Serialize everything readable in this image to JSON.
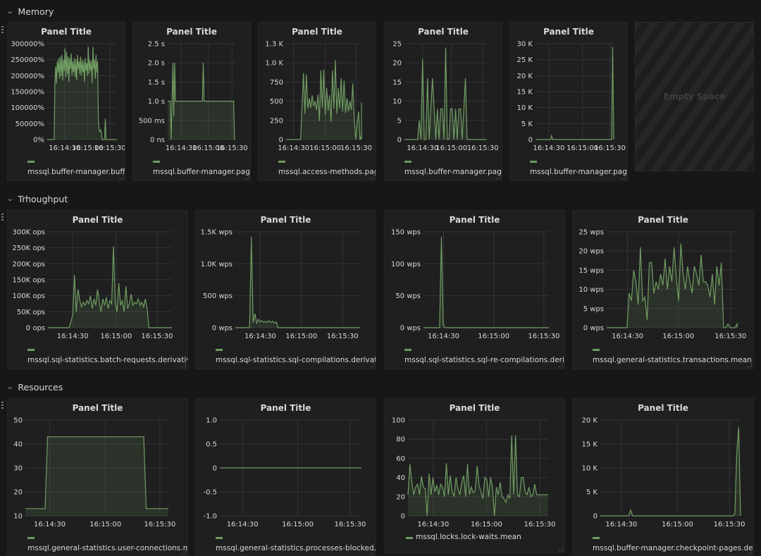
{
  "rows": [
    {
      "title": "Memory"
    },
    {
      "title": "Trhoughput"
    },
    {
      "title": "Resources"
    }
  ],
  "empty_space_label": "Empty Space",
  "series_color": "#7eb26d",
  "chart_data": [
    {
      "id": "p0",
      "type": "area",
      "title": "Panel Title",
      "row": "Memory",
      "y_ticks": [
        "300000%",
        "250000%",
        "200000%",
        "150000%",
        "100000%",
        "50000%",
        "0%"
      ],
      "ylim": [
        0,
        300000
      ],
      "x_ticks": [
        "16:14:30",
        "16:15:00",
        "16:15:30"
      ],
      "legend": "mssql.buffer-manager.buffer-ca",
      "x": [
        0,
        3,
        6,
        9,
        10,
        11,
        12,
        13,
        14,
        15,
        16,
        17,
        18,
        19,
        20,
        21,
        22,
        23,
        24,
        25,
        26,
        27,
        28,
        29,
        30,
        31,
        32,
        33,
        34,
        35,
        36,
        37,
        38,
        39,
        40,
        41,
        42,
        43,
        44,
        45,
        46,
        47,
        48,
        49,
        50,
        51,
        52,
        53,
        54,
        55,
        56,
        57,
        58,
        59,
        60,
        61,
        62,
        63,
        64,
        65,
        66,
        67,
        68,
        69,
        70,
        71,
        72,
        73,
        74,
        75,
        76,
        77,
        78,
        79,
        80,
        82,
        84,
        86,
        88,
        90
      ],
      "values": [
        0,
        0,
        0,
        0,
        180000,
        230000,
        175000,
        245000,
        210000,
        255000,
        190000,
        260000,
        200000,
        265000,
        185000,
        250000,
        215000,
        285000,
        195000,
        275000,
        205000,
        260000,
        180000,
        255000,
        220000,
        270000,
        200000,
        245000,
        210000,
        255000,
        195000,
        250000,
        185000,
        265000,
        220000,
        245000,
        205000,
        260000,
        200000,
        250000,
        210000,
        245000,
        180000,
        255000,
        215000,
        240000,
        200000,
        290000,
        205000,
        250000,
        215000,
        245000,
        175000,
        290000,
        220000,
        250000,
        190000,
        265000,
        210000,
        245000,
        60000,
        30000,
        25000,
        30000,
        20000,
        0,
        0,
        0,
        0,
        65000,
        0,
        0,
        0,
        0,
        0,
        0,
        0,
        0,
        0,
        0
      ],
      "x_range": [
        0,
        90
      ]
    },
    {
      "id": "p1",
      "type": "area",
      "title": "Panel Title",
      "row": "Memory",
      "y_ticks": [
        "2.5 s",
        "2.0 s",
        "1.5 s",
        "1.0 s",
        "500 ms",
        "0 ns"
      ],
      "ylim": [
        0,
        2.5
      ],
      "x_ticks": [
        "16:14:30",
        "16:15:00",
        "16:15:30"
      ],
      "legend": "mssql.buffer-manager.page-life",
      "x": [
        0,
        3,
        4,
        5,
        6,
        7,
        8,
        9,
        10,
        11,
        40,
        41,
        42,
        76,
        77,
        78
      ],
      "values": [
        1,
        1,
        0,
        1,
        2,
        0.6,
        2,
        1,
        1,
        1,
        1,
        2,
        1,
        1,
        0,
        0
      ],
      "x_range": [
        0,
        78
      ]
    },
    {
      "id": "p2",
      "type": "area",
      "title": "Panel Title",
      "row": "Memory",
      "y_ticks": [
        "1.3 K",
        "1.0 K",
        "750",
        "500",
        "250",
        "0"
      ],
      "ylim": [
        0,
        1300
      ],
      "x_ticks": [
        "16:14:30",
        "16:15:00",
        "16:15:30"
      ],
      "legend": "mssql.access-methods.page-spl",
      "x": [
        0,
        10,
        12,
        13,
        14,
        15,
        16,
        17,
        18,
        19,
        20,
        21,
        22,
        23,
        24,
        25,
        26,
        27,
        28,
        29,
        30,
        31,
        32,
        33,
        34,
        35,
        36,
        37,
        38,
        39,
        40,
        41,
        42,
        43,
        44,
        45,
        46,
        47,
        48,
        49,
        50,
        51,
        52,
        53,
        54,
        55,
        56,
        57,
        58,
        59,
        60,
        61,
        62,
        63,
        64,
        65,
        66,
        67,
        68,
        69,
        70,
        71,
        72
      ],
      "values": [
        0,
        0,
        900,
        350,
        880,
        420,
        560,
        430,
        600,
        450,
        520,
        400,
        610,
        250,
        940,
        430,
        950,
        330,
        700,
        390,
        600,
        240,
        940,
        420,
        1080,
        350,
        700,
        420,
        830,
        380,
        800,
        360,
        560,
        380,
        520,
        400,
        760,
        300,
        0,
        200,
        380,
        0,
        50,
        500,
        0,
        0,
        0,
        0,
        0,
        0,
        0,
        0,
        0,
        0,
        0,
        0,
        0,
        0,
        0,
        0,
        0,
        0,
        0
      ],
      "x_range": [
        0,
        52
      ]
    },
    {
      "id": "p3",
      "type": "area",
      "title": "Panel Title",
      "row": "Memory",
      "y_ticks": [
        "25",
        "20",
        "15",
        "10",
        "5",
        "0"
      ],
      "ylim": [
        0,
        25
      ],
      "x_ticks": [
        "16:14:30",
        "16:15:00",
        "16:15:30"
      ],
      "legend": "mssql.buffer-manager.page-rea",
      "x": [
        0,
        8,
        9,
        10,
        11,
        12,
        13,
        14,
        15,
        16,
        17,
        18,
        19,
        20,
        21,
        22,
        23,
        24,
        25,
        26,
        27,
        28,
        29,
        30,
        31,
        32,
        33,
        34,
        35,
        36,
        37,
        38,
        39,
        40,
        41,
        42,
        43,
        44,
        50
      ],
      "values": [
        0,
        0,
        5,
        0,
        21,
        0,
        0,
        16,
        0,
        8,
        16,
        8,
        0,
        8,
        0,
        8,
        8,
        0,
        24,
        0,
        0,
        8,
        8,
        0,
        8,
        0,
        8,
        8,
        0,
        8,
        16,
        0,
        0,
        0,
        0,
        0,
        0,
        0,
        0
      ],
      "x_range": [
        0,
        50
      ]
    },
    {
      "id": "p4",
      "type": "area",
      "title": "Panel Title",
      "row": "Memory",
      "y_ticks": [
        "30 K",
        "25 K",
        "20 K",
        "15 K",
        "10 K",
        "5 K",
        "0"
      ],
      "ylim": [
        0,
        30000
      ],
      "x_ticks": [
        "16:14:30",
        "16:15:00",
        "16:15:30"
      ],
      "legend": "mssql.buffer-manager.page-writes.derivative",
      "x": [
        0,
        14,
        15,
        16,
        70,
        71,
        72,
        73
      ],
      "values": [
        0,
        0,
        1200,
        0,
        0,
        0,
        29000,
        0
      ],
      "x_range": [
        0,
        73
      ]
    },
    {
      "id": "p5",
      "type": "area",
      "title": "Panel Title",
      "row": "Trhoughput",
      "y_ticks": [
        "300K ops",
        "250K ops",
        "200K ops",
        "150K ops",
        "100K ops",
        "50K ops",
        "0 ops"
      ],
      "ylim": [
        0,
        300000
      ],
      "x_ticks": [
        "16:14:30",
        "16:15:00",
        "16:15:30"
      ],
      "legend": "mssql.sql-statistics.batch-requests.derivative",
      "x": [
        0,
        12,
        14,
        15,
        16,
        17,
        18,
        19,
        20,
        21,
        22,
        23,
        24,
        25,
        26,
        27,
        28,
        29,
        30,
        31,
        32,
        33,
        34,
        35,
        36,
        37,
        38,
        39,
        40,
        41,
        42,
        43,
        44,
        45,
        46,
        47,
        48,
        49,
        50,
        51,
        52,
        53,
        54,
        55,
        56,
        57,
        58,
        59,
        60,
        61,
        62,
        63,
        64,
        65,
        66,
        70
      ],
      "values": [
        0,
        0,
        40000,
        165000,
        50000,
        120000,
        85000,
        65000,
        80000,
        70000,
        85000,
        75000,
        100000,
        60000,
        90000,
        70000,
        120000,
        80000,
        50000,
        90000,
        70000,
        95000,
        60000,
        85000,
        75000,
        255000,
        80000,
        50000,
        140000,
        70000,
        85000,
        50000,
        130000,
        60000,
        75000,
        105000,
        70000,
        80000,
        75000,
        90000,
        70000,
        80000,
        65000,
        90000,
        60000,
        0,
        0,
        0,
        0,
        0,
        0,
        0,
        0,
        0,
        0,
        0
      ],
      "x_range": [
        0,
        70
      ]
    },
    {
      "id": "p6",
      "type": "area",
      "title": "Panel Title",
      "row": "Trhoughput",
      "y_ticks": [
        "1.5K wps",
        "1.0K wps",
        "500 wps",
        "0 wps"
      ],
      "ylim": [
        0,
        1500
      ],
      "x_ticks": [
        "16:14:30",
        "16:15:00",
        "16:15:30"
      ],
      "legend": "mssql.sql-statistics.sql-compilations.derivative",
      "x": [
        0,
        8,
        9,
        10,
        11,
        12,
        13,
        14,
        15,
        16,
        17,
        18,
        19,
        20,
        21,
        22,
        23,
        24,
        25,
        26,
        27,
        70
      ],
      "values": [
        0,
        0,
        1420,
        80,
        220,
        70,
        130,
        90,
        110,
        80,
        100,
        85,
        110,
        80,
        100,
        70,
        90,
        0,
        0,
        0,
        0,
        0
      ],
      "x_range": [
        0,
        70
      ]
    },
    {
      "id": "p7",
      "type": "area",
      "title": "Panel Title",
      "row": "Trhoughput",
      "y_ticks": [
        "150 wps",
        "100 wps",
        "50 wps",
        "0 wps"
      ],
      "ylim": [
        0,
        150
      ],
      "x_ticks": [
        "16:14:30",
        "16:15:00",
        "16:15:30"
      ],
      "legend": "mssql.sql-statistics.sql-re-compilations.derivative",
      "x": [
        0,
        9,
        10,
        11,
        12,
        70
      ],
      "values": [
        0,
        0,
        142,
        5,
        0,
        0
      ],
      "x_range": [
        0,
        70
      ]
    },
    {
      "id": "p8",
      "type": "area",
      "title": "Panel Title",
      "row": "Trhoughput",
      "y_ticks": [
        "25 wps",
        "20 wps",
        "15 wps",
        "10 wps",
        "5 wps",
        "0 wps"
      ],
      "ylim": [
        0,
        25
      ],
      "x_ticks": [
        "16:14:30",
        "16:15:00",
        "16:15:30"
      ],
      "legend": "mssql.general-statistics.transactions.mean",
      "x": [
        0,
        9,
        10,
        11,
        12,
        13,
        14,
        15,
        16,
        17,
        18,
        19,
        20,
        21,
        22,
        23,
        24,
        25,
        26,
        27,
        28,
        29,
        30,
        31,
        32,
        33,
        34,
        35,
        36,
        37,
        38,
        39,
        40,
        41,
        42,
        43,
        44,
        45,
        46,
        47,
        48,
        49,
        50,
        51,
        52,
        53,
        54,
        55,
        56,
        57,
        58,
        59,
        60,
        61,
        62,
        63,
        64,
        65
      ],
      "values": [
        0,
        0,
        9,
        7,
        15,
        12,
        6,
        21,
        7,
        8,
        2,
        17,
        17,
        9,
        12,
        10,
        14,
        11,
        18,
        10,
        16,
        12,
        21,
        13,
        7,
        22,
        14,
        10,
        16,
        12,
        9,
        16,
        14,
        11,
        19,
        12,
        12,
        11,
        8,
        14,
        6,
        16,
        11,
        17,
        0,
        0,
        1,
        0,
        0,
        0,
        1,
        0,
        0,
        0,
        0,
        0,
        0,
        0
      ],
      "x_range": [
        0,
        58
      ]
    },
    {
      "id": "p9",
      "type": "area",
      "title": "Panel Title",
      "row": "Resources",
      "y_ticks": [
        "50",
        "40",
        "30",
        "20",
        "10"
      ],
      "ylim": [
        10,
        50
      ],
      "x_ticks": [
        "16:14:30",
        "16:15:00",
        "16:15:30"
      ],
      "legend": "mssql.general-statistics.user-connections.mean",
      "x": [
        0,
        8,
        9,
        48,
        49,
        58
      ],
      "values": [
        13,
        13,
        43,
        43,
        13,
        13
      ],
      "x_range": [
        0,
        58
      ]
    },
    {
      "id": "p10",
      "type": "line",
      "title": "Panel Title",
      "row": "Resources",
      "y_ticks": [
        "1.0",
        "0.5",
        "0",
        "-0.5",
        "-1.0"
      ],
      "ylim": [
        -1,
        1
      ],
      "x_ticks": [
        "16:14:30",
        "16:15:00",
        "16:15:30"
      ],
      "legend": "mssql.general-statistics.processes-blocked.mean",
      "x": [
        0,
        58
      ],
      "values": [
        0,
        0
      ],
      "x_range": [
        0,
        58
      ]
    },
    {
      "id": "p11",
      "type": "area",
      "title": "Panel Title",
      "row": "Resources",
      "y_ticks": [
        "100",
        "80",
        "60",
        "40",
        "20",
        "0"
      ],
      "ylim": [
        0,
        100
      ],
      "x_ticks": [
        "16:14:30",
        "16:15:00",
        "16:15:30"
      ],
      "legend": "mssql.locks.lock-waits.mean",
      "legend_inline": true,
      "x": [
        0,
        1,
        2,
        3,
        4,
        5,
        6,
        7,
        8,
        9,
        10,
        11,
        12,
        13,
        14,
        15,
        16,
        17,
        18,
        19,
        20,
        21,
        22,
        23,
        24,
        25,
        26,
        27,
        28,
        29,
        30,
        31,
        32,
        33,
        34,
        35,
        36,
        37,
        38,
        39,
        40,
        41,
        42,
        43,
        44,
        45,
        46,
        47,
        48,
        49,
        50,
        51,
        52,
        53,
        54,
        55,
        56,
        57,
        58,
        59,
        60,
        61,
        62,
        63,
        64,
        65,
        66,
        67,
        68,
        69,
        70,
        71,
        72,
        73
      ],
      "values": [
        22,
        54,
        35,
        22,
        30,
        33,
        22,
        41,
        30,
        28,
        0,
        44,
        22,
        40,
        25,
        32,
        22,
        33,
        30,
        20,
        55,
        22,
        42,
        25,
        20,
        40,
        28,
        22,
        35,
        42,
        20,
        54,
        22,
        30,
        24,
        26,
        52,
        32,
        25,
        18,
        40,
        38,
        20,
        40,
        30,
        0,
        30,
        22,
        35,
        20,
        18,
        14,
        22,
        18,
        84,
        22,
        84,
        22,
        20,
        40,
        40,
        25,
        22,
        30,
        20,
        22,
        33,
        22,
        22,
        22,
        22,
        22,
        22,
        22
      ],
      "x_range": [
        0,
        73
      ]
    },
    {
      "id": "p12",
      "type": "area",
      "title": "Panel Title",
      "row": "Resources",
      "y_ticks": [
        "20 K",
        "15 K",
        "10 K",
        "5 K",
        "0"
      ],
      "ylim": [
        0,
        20000
      ],
      "x_ticks": [
        "16:14:30",
        "16:15:00",
        "16:15:30"
      ],
      "legend": "mssql.buffer-manager.checkpoint-pages.derivative",
      "x": [
        0,
        15,
        16,
        17,
        70,
        71,
        72,
        73,
        74
      ],
      "values": [
        0,
        0,
        1200,
        0,
        0,
        500,
        13000,
        18500,
        0
      ],
      "x_range": [
        0,
        74
      ]
    }
  ]
}
